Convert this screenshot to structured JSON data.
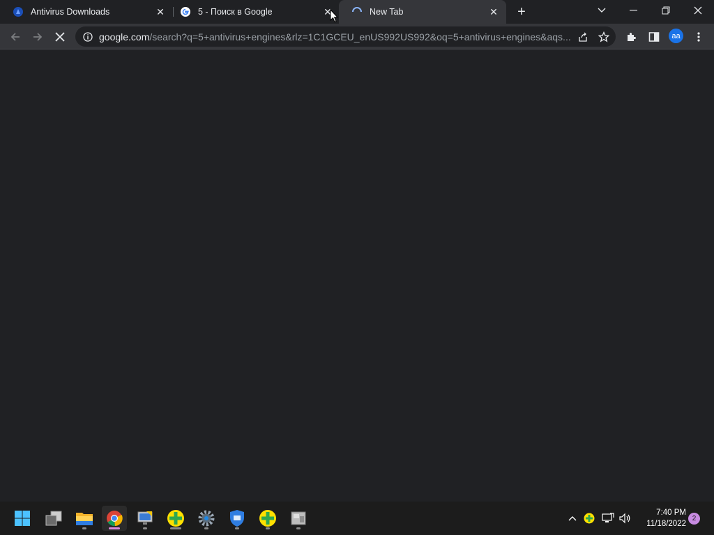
{
  "browser": {
    "tabs": [
      {
        "title": "Antivirus Downloads",
        "favicon": "avast-icon",
        "active": false
      },
      {
        "title": "5 - Поиск в Google",
        "favicon": "google-icon",
        "active": false
      },
      {
        "title": "New Tab",
        "favicon": "loading-spinner-icon",
        "active": true
      }
    ],
    "url_host": "google.com",
    "url_path": "/search?q=5+antivirus+engines&rlz=1C1GCEU_enUS992US992&oq=5+antivirus+engines&aqs...",
    "profile_initials": "aa",
    "accent": "#1a73e8"
  },
  "taskbar": {
    "time": "7:40 PM",
    "date": "11/18/2022",
    "notification_count": "2",
    "apps": [
      "start-icon",
      "task-view-icon",
      "file-explorer-icon",
      "chrome-icon",
      "remote-desktop-icon",
      "antivirus-plus-icon",
      "settings-icon",
      "defender-shield-icon",
      "antivirus-plus-icon-2",
      "network-app-icon"
    ]
  }
}
